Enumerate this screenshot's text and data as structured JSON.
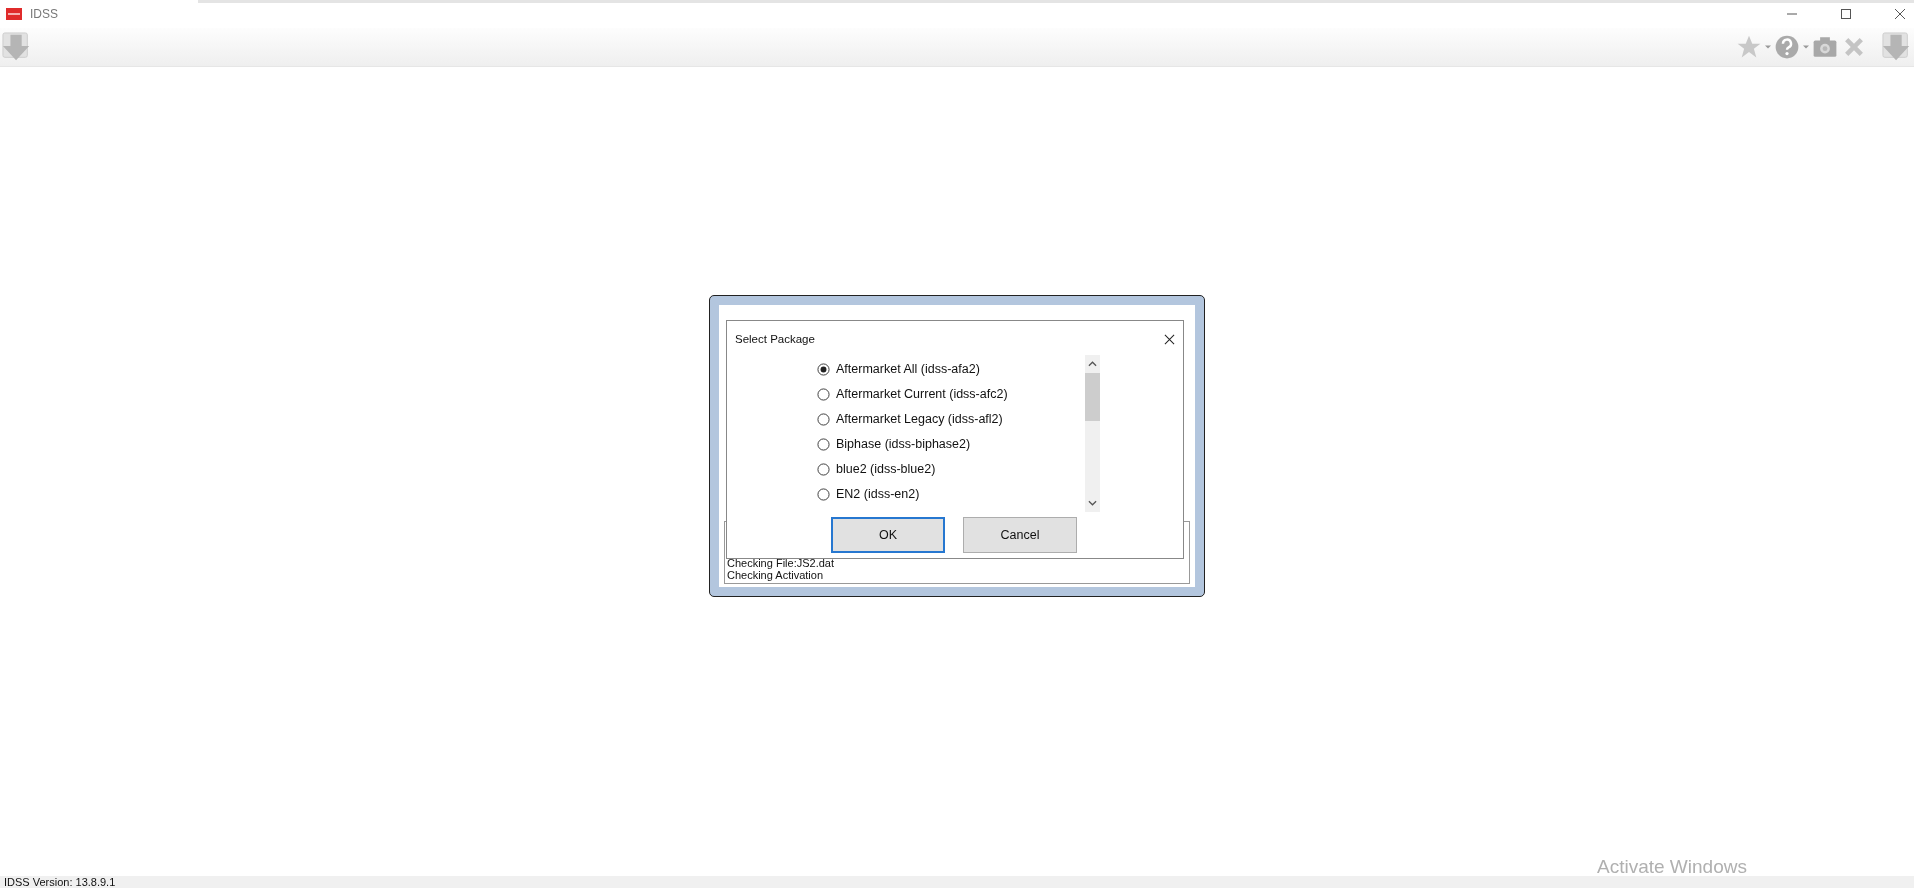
{
  "window": {
    "title": "IDSS"
  },
  "log": {
    "lines": [
      "Checking File:JS2.dat",
      "Checking Activation"
    ]
  },
  "dialog": {
    "title": "Select Package",
    "packages": [
      {
        "label": "Aftermarket All (idss-afa2)",
        "selected": true
      },
      {
        "label": "Aftermarket Current (idss-afc2)",
        "selected": false
      },
      {
        "label": "Aftermarket Legacy (idss-afl2)",
        "selected": false
      },
      {
        "label": "Biphase (idss-biphase2)",
        "selected": false
      },
      {
        "label": "blue2 (idss-blue2)",
        "selected": false
      },
      {
        "label": "EN2 (idss-en2)",
        "selected": false
      }
    ],
    "buttons": [
      {
        "label": "OK",
        "focused": true
      },
      {
        "label": "Cancel",
        "focused": false
      }
    ]
  },
  "status_bar": {
    "text": "IDSS Version: 13.8.9.1"
  },
  "system_notice": {
    "text": "Activate Windows"
  }
}
